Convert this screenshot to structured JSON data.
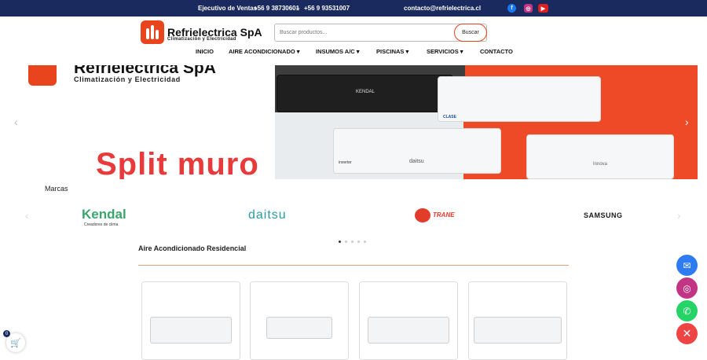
{
  "topbar": {
    "ventas_label": "Ejecutivo de Ventas",
    "phone1": "+56 9 38730601",
    "separator": "–",
    "phone2": "+56 9 93531007",
    "email": "contacto@refrielectrica.cl",
    "social": [
      "facebook-icon",
      "instagram-icon",
      "youtube-icon"
    ]
  },
  "brand": {
    "name": "Refrielectrica SpA",
    "tagline": "Climatización y Electricidad"
  },
  "search": {
    "placeholder": "Buscar productos...",
    "button": "Buscar"
  },
  "nav": [
    {
      "label": "INICIO"
    },
    {
      "label": "AIRE ACONDICIONADO ▾"
    },
    {
      "label": "INSUMOS A/C ▾"
    },
    {
      "label": "PISCINAS ▾"
    },
    {
      "label": "SERVICIOS ▾"
    },
    {
      "label": "CONTACTO"
    }
  ],
  "hero": {
    "brand": "Refrielectrica SpA",
    "tagline": "Climatización y Electricidad",
    "title": "Split muro",
    "unit_labels": [
      "KENDAL",
      "CLASE",
      "inverter",
      "daitsu",
      "Innova"
    ]
  },
  "marcas": {
    "title": "Marcas",
    "brands": [
      "Kendal",
      "Creadores de clima",
      "daitsu",
      "TRANE",
      "SAMSUNG"
    ]
  },
  "section": {
    "title": "Aire Acondicionado Residencial"
  },
  "cart": {
    "count": "0"
  },
  "colors": {
    "topbar": "#1b2a5e",
    "accent": "#e8451e",
    "messenger": "#2f7bf2",
    "instagram": "#c13584",
    "whatsapp": "#25d366",
    "close": "#ef4444"
  }
}
